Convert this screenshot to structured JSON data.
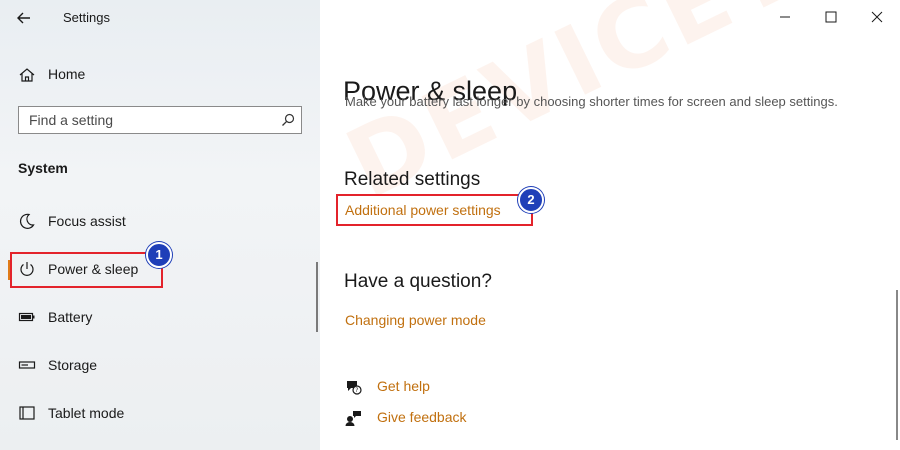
{
  "window": {
    "title": "Settings",
    "controls": {
      "minimize": "minimize-icon",
      "maximize": "maximize-icon",
      "close": "close-icon"
    }
  },
  "sidebar": {
    "home_label": "Home",
    "search_placeholder": "Find a setting",
    "group_label": "System",
    "items": [
      {
        "label": "Focus assist",
        "icon": "moon-icon"
      },
      {
        "label": "Power & sleep",
        "icon": "power-icon",
        "active": true
      },
      {
        "label": "Battery",
        "icon": "battery-icon"
      },
      {
        "label": "Storage",
        "icon": "storage-icon"
      },
      {
        "label": "Tablet mode",
        "icon": "tablet-icon"
      }
    ]
  },
  "main": {
    "title": "Power & sleep",
    "description": "Make your battery last longer by choosing shorter times for screen and sleep settings.",
    "related": {
      "heading": "Related settings",
      "link": "Additional power settings"
    },
    "question": {
      "heading": "Have a question?",
      "link": "Changing power mode"
    },
    "help_links": [
      {
        "label": "Get help",
        "icon": "help-chat-icon"
      },
      {
        "label": "Give feedback",
        "icon": "feedback-icon"
      }
    ]
  },
  "annotations": {
    "badge1": "1",
    "badge2": "2"
  },
  "watermark": "DEVICETRICKS",
  "colors": {
    "accent": "#e07b18",
    "link": "#c1700f",
    "highlight": "#e3232b",
    "badge": "#1f3fb8"
  }
}
